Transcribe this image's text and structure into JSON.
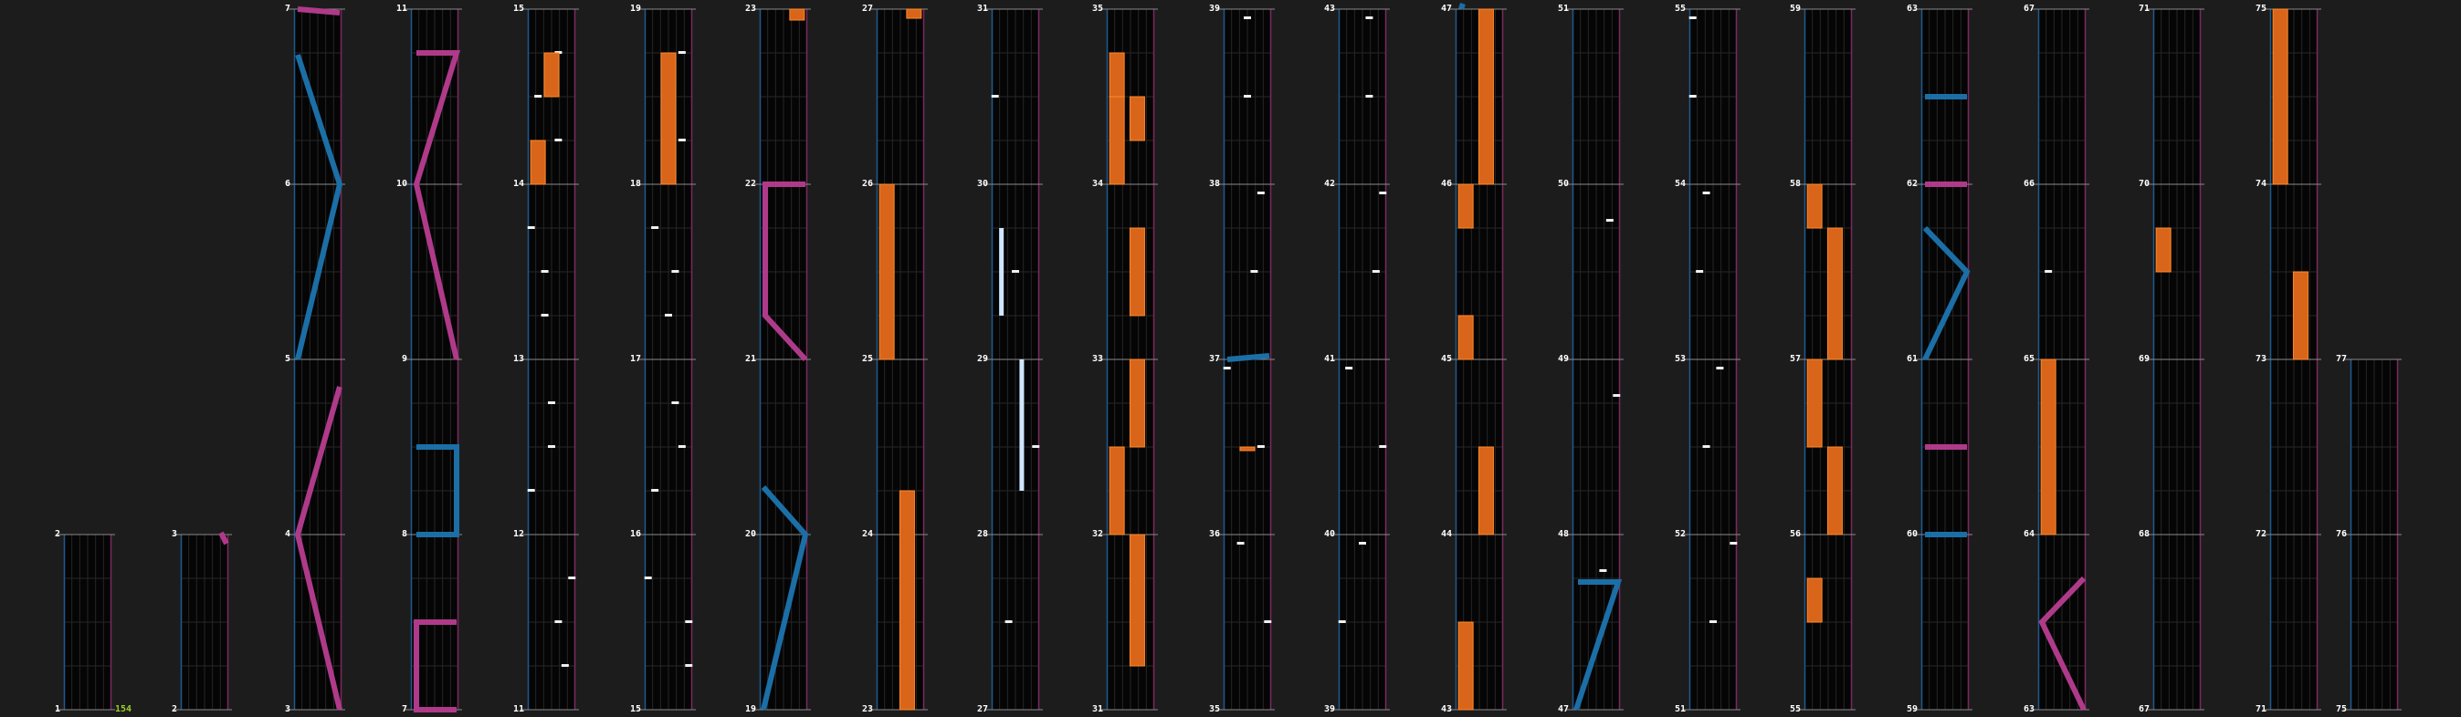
{
  "editor": {
    "combo_count": "154",
    "colors": {
      "background": "#1c1c1c",
      "lane_background": "#050505",
      "lane_grid": "#262626",
      "measure_line": "#8a8a8a",
      "left_border": "#1e5a90",
      "right_border": "#7a2a5e",
      "tap_note": "#f0f0f0",
      "hold_note": "#d8651a",
      "hold_note_edge": "#ff8a2a",
      "flick_note": "#cfe6ff",
      "blue_slide": "#1b6fa6",
      "pink_slide": "#b03a8a"
    },
    "columns": [
      {
        "measures": [
          "1",
          "2"
        ]
      },
      {
        "measures": [
          "2",
          "3"
        ]
      },
      {
        "measures": [
          "3",
          "4",
          "5",
          "6",
          "7"
        ]
      },
      {
        "measures": [
          "7",
          "8",
          "9",
          "10",
          "11"
        ]
      },
      {
        "measures": [
          "11",
          "12",
          "13",
          "14",
          "15"
        ]
      },
      {
        "measures": [
          "15",
          "16",
          "17",
          "18",
          "19"
        ]
      },
      {
        "measures": [
          "19",
          "20",
          "21",
          "22",
          "23"
        ]
      },
      {
        "measures": [
          "23",
          "24",
          "25",
          "26",
          "27"
        ]
      },
      {
        "measures": [
          "27",
          "28",
          "29",
          "30",
          "31"
        ]
      },
      {
        "measures": [
          "31",
          "32",
          "33",
          "34",
          "35"
        ]
      },
      {
        "measures": [
          "35",
          "36",
          "37",
          "38",
          "39"
        ]
      },
      {
        "measures": [
          "39",
          "40",
          "41",
          "42",
          "43"
        ]
      },
      {
        "measures": [
          "43",
          "44",
          "45",
          "46",
          "47"
        ]
      },
      {
        "measures": [
          "47",
          "48",
          "49",
          "50",
          "51"
        ]
      },
      {
        "measures": [
          "51",
          "52",
          "53",
          "54",
          "55"
        ]
      },
      {
        "measures": [
          "55",
          "56",
          "57",
          "58",
          "59"
        ]
      },
      {
        "measures": [
          "59",
          "60",
          "61",
          "62",
          "63"
        ]
      },
      {
        "measures": [
          "63",
          "64",
          "65",
          "66",
          "67"
        ]
      },
      {
        "measures": [
          "67",
          "68",
          "69",
          "70",
          "71"
        ]
      },
      {
        "measures": [
          "71",
          "72",
          "73",
          "74",
          "75"
        ]
      },
      {
        "measures": [
          "75",
          "76",
          "77"
        ]
      }
    ]
  }
}
